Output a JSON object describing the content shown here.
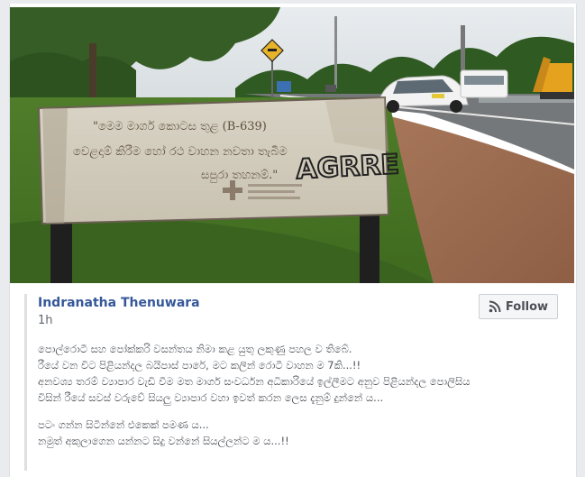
{
  "post": {
    "author": "Indranatha Thenuwara",
    "time": "1h",
    "follow_label": "Follow",
    "follow_icon": "rss-icon",
    "paragraph1": [
      "පොල්රොටී සහ පෝක්කරි වසන්තය නිමා කළ යුතු ලකුණු පහල ව තිබේ.",
      "රීයේ වන විට පිළියන්දල බයිපාස් පාරේ, මට කලින් රොටී වාහන ම 7කි...!!",
      "අනවශ්‍ය තරම් ව්‍යාපාර වැඩි වීම මත මාර්ග සංවර්ධන අධිකාරියේ ඉල්ලීමට අනුව පිළියන්දල පොලිසිය",
      "විසින් රීයේ සවස් වරුවේ සියලු ව්‍යාපාර වහා ඉවත් කරන ලෙස දැනුම් දුන්නේ ය..."
    ],
    "paragraph2": [
      "පටං ගන්න සිටින්නේ එකෙක් පමණ ය...",
      "නමුත් අකුලාගෙන යන්නට සිදු වන්නේ සියල්ලන්ට ම ය...!!"
    ]
  },
  "photo": {
    "sign_text_line1": "\"මෙම මාර්ග කොටස තුළ (B-639)",
    "sign_text_line2": "වෙළදාම් කිරීම හෝ රථ වාහන නවතා තැබීම",
    "sign_text_line3": "සපුරා තහනම්.\"",
    "graffiti": "AGRRE",
    "license_plate": "",
    "road_sign_icon": "animal-crossing-sign-icon"
  }
}
